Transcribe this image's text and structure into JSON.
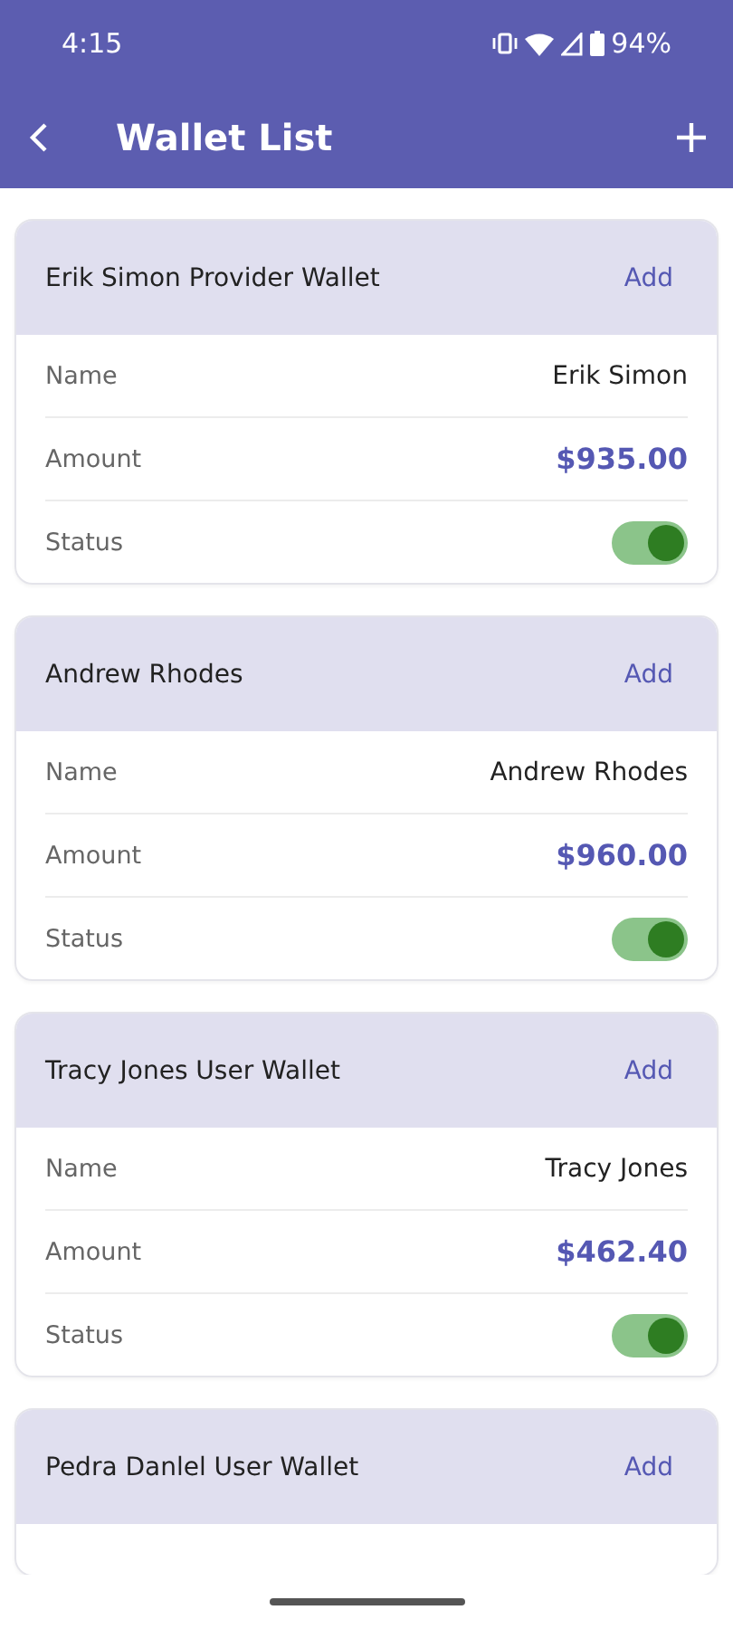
{
  "status_bar": {
    "time": "4:15",
    "battery": "94%"
  },
  "app_bar": {
    "title": "Wallet List"
  },
  "wallets": [
    {
      "title": "Erik Simon Provider Wallet",
      "action": "Add",
      "rows": [
        {
          "kind": "text",
          "label": "Name",
          "value": "Erik Simon"
        },
        {
          "kind": "amount",
          "label": "Amount",
          "value": "$935.00"
        },
        {
          "kind": "toggle",
          "label": "Status",
          "on": true
        }
      ]
    },
    {
      "title": "Andrew Rhodes",
      "action": "Add",
      "rows": [
        {
          "kind": "text",
          "label": "Name",
          "value": "Andrew Rhodes"
        },
        {
          "kind": "amount",
          "label": "Amount",
          "value": "$960.00"
        },
        {
          "kind": "toggle",
          "label": "Status",
          "on": true
        }
      ]
    },
    {
      "title": "Tracy Jones User Wallet",
      "action": "Add",
      "rows": [
        {
          "kind": "text",
          "label": "Name",
          "value": "Tracy Jones"
        },
        {
          "kind": "amount",
          "label": "Amount",
          "value": "$462.40"
        },
        {
          "kind": "toggle",
          "label": "Status",
          "on": true
        }
      ]
    },
    {
      "title": "Pedra Danlel User Wallet",
      "action": "Add"
    }
  ]
}
